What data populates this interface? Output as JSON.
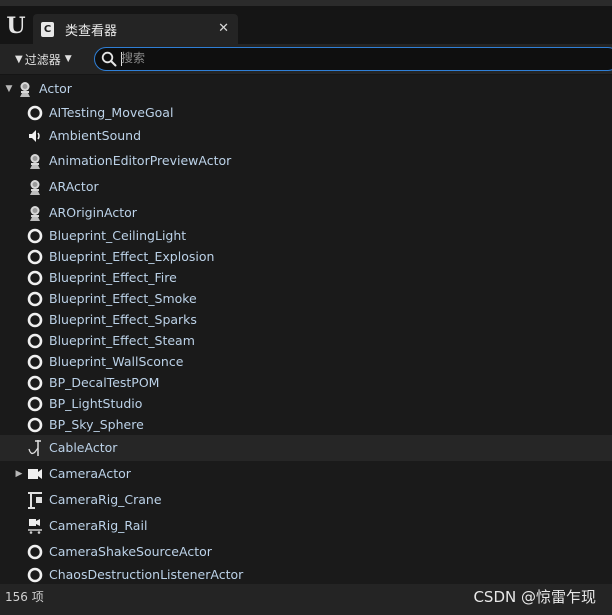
{
  "window": {
    "tab_title": "类查看器",
    "tab_icon_letter": "C",
    "logo_text": "U"
  },
  "toolbar": {
    "filter_label": "过滤器",
    "search_placeholder": "搜索"
  },
  "tree": {
    "root": {
      "label": "Actor",
      "icon": "actor-icon",
      "expanded": true
    },
    "items": [
      {
        "label": "AITesting_MoveGoal",
        "icon": "blueprint-circle-icon"
      },
      {
        "label": "AmbientSound",
        "icon": "speaker-icon"
      },
      {
        "label": "AnimationEditorPreviewActor",
        "icon": "actor-icon"
      },
      {
        "label": "ARActor",
        "icon": "actor-icon"
      },
      {
        "label": "AROriginActor",
        "icon": "actor-icon"
      },
      {
        "label": "Blueprint_CeilingLight",
        "icon": "blueprint-circle-icon"
      },
      {
        "label": "Blueprint_Effect_Explosion",
        "icon": "blueprint-circle-icon"
      },
      {
        "label": "Blueprint_Effect_Fire",
        "icon": "blueprint-circle-icon"
      },
      {
        "label": "Blueprint_Effect_Smoke",
        "icon": "blueprint-circle-icon"
      },
      {
        "label": "Blueprint_Effect_Sparks",
        "icon": "blueprint-circle-icon"
      },
      {
        "label": "Blueprint_Effect_Steam",
        "icon": "blueprint-circle-icon"
      },
      {
        "label": "Blueprint_WallSconce",
        "icon": "blueprint-circle-icon"
      },
      {
        "label": "BP_DecalTestPOM",
        "icon": "blueprint-circle-icon"
      },
      {
        "label": "BP_LightStudio",
        "icon": "blueprint-circle-icon"
      },
      {
        "label": "BP_Sky_Sphere",
        "icon": "blueprint-circle-icon"
      },
      {
        "label": "CableActor",
        "icon": "cable-icon"
      },
      {
        "label": "CameraActor",
        "icon": "camera-icon",
        "has_children": true
      },
      {
        "label": "CameraRig_Crane",
        "icon": "crane-icon"
      },
      {
        "label": "CameraRig_Rail",
        "icon": "rail-icon"
      },
      {
        "label": "CameraShakeSourceActor",
        "icon": "blueprint-circle-icon"
      },
      {
        "label": "ChaosDestructionListenerActor",
        "icon": "blueprint-circle-icon"
      }
    ]
  },
  "status": {
    "count_text": "156 项",
    "watermark": "CSDN @惊雷乍现"
  },
  "colors": {
    "accent": "#2f7fd6",
    "label": "#bcd2e8",
    "background": "#1a1a1a"
  }
}
